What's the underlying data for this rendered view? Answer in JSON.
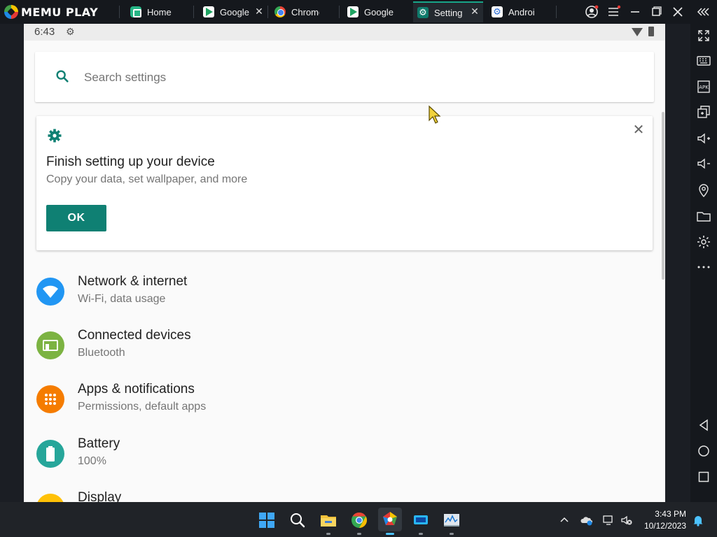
{
  "emulator": {
    "brand": "MEMU PLAY",
    "tabs": [
      {
        "label": "Home",
        "icon": "home-icon"
      },
      {
        "label": "Google",
        "icon": "play-store-icon"
      },
      {
        "label": "Chrome",
        "icon": "chrome-icon"
      },
      {
        "label": "Google",
        "icon": "play-store-icon"
      },
      {
        "label": "Setting",
        "icon": "settings-gear-icon",
        "active": true
      },
      {
        "label": "Androi",
        "icon": "android-settings-icon"
      }
    ],
    "tab_close_glyph": "✕",
    "sidebar_tools": [
      "fullscreen-icon",
      "keyboard-icon",
      "apk-icon",
      "multi-window-icon",
      "volume-up-icon",
      "volume-down-icon",
      "location-icon",
      "folder-icon",
      "settings-icon",
      "more-icon",
      "back-icon",
      "home-icon",
      "recents-icon"
    ]
  },
  "android": {
    "status_bar": {
      "time": "6:43"
    },
    "search": {
      "placeholder": "Search settings"
    },
    "setup_card": {
      "title": "Finish setting up your device",
      "subtitle": "Copy your data, set wallpaper, and more",
      "ok_label": "OK"
    },
    "settings": [
      {
        "title": "Network & internet",
        "subtitle": "Wi-Fi, data usage",
        "icon": "wifi-icon",
        "color": "#2196f3"
      },
      {
        "title": "Connected devices",
        "subtitle": "Bluetooth",
        "icon": "devices-icon",
        "color": "#7cb342"
      },
      {
        "title": "Apps & notifications",
        "subtitle": "Permissions, default apps",
        "icon": "apps-icon",
        "color": "#f57c00"
      },
      {
        "title": "Battery",
        "subtitle": "100%",
        "icon": "battery-icon",
        "color": "#26a69a"
      },
      {
        "title": "Display",
        "subtitle": "",
        "icon": "display-icon",
        "color": "#ffc107"
      }
    ],
    "accent_color": "#0f8073"
  },
  "taskbar": {
    "time": "3:43 PM",
    "date": "10/12/2023"
  }
}
